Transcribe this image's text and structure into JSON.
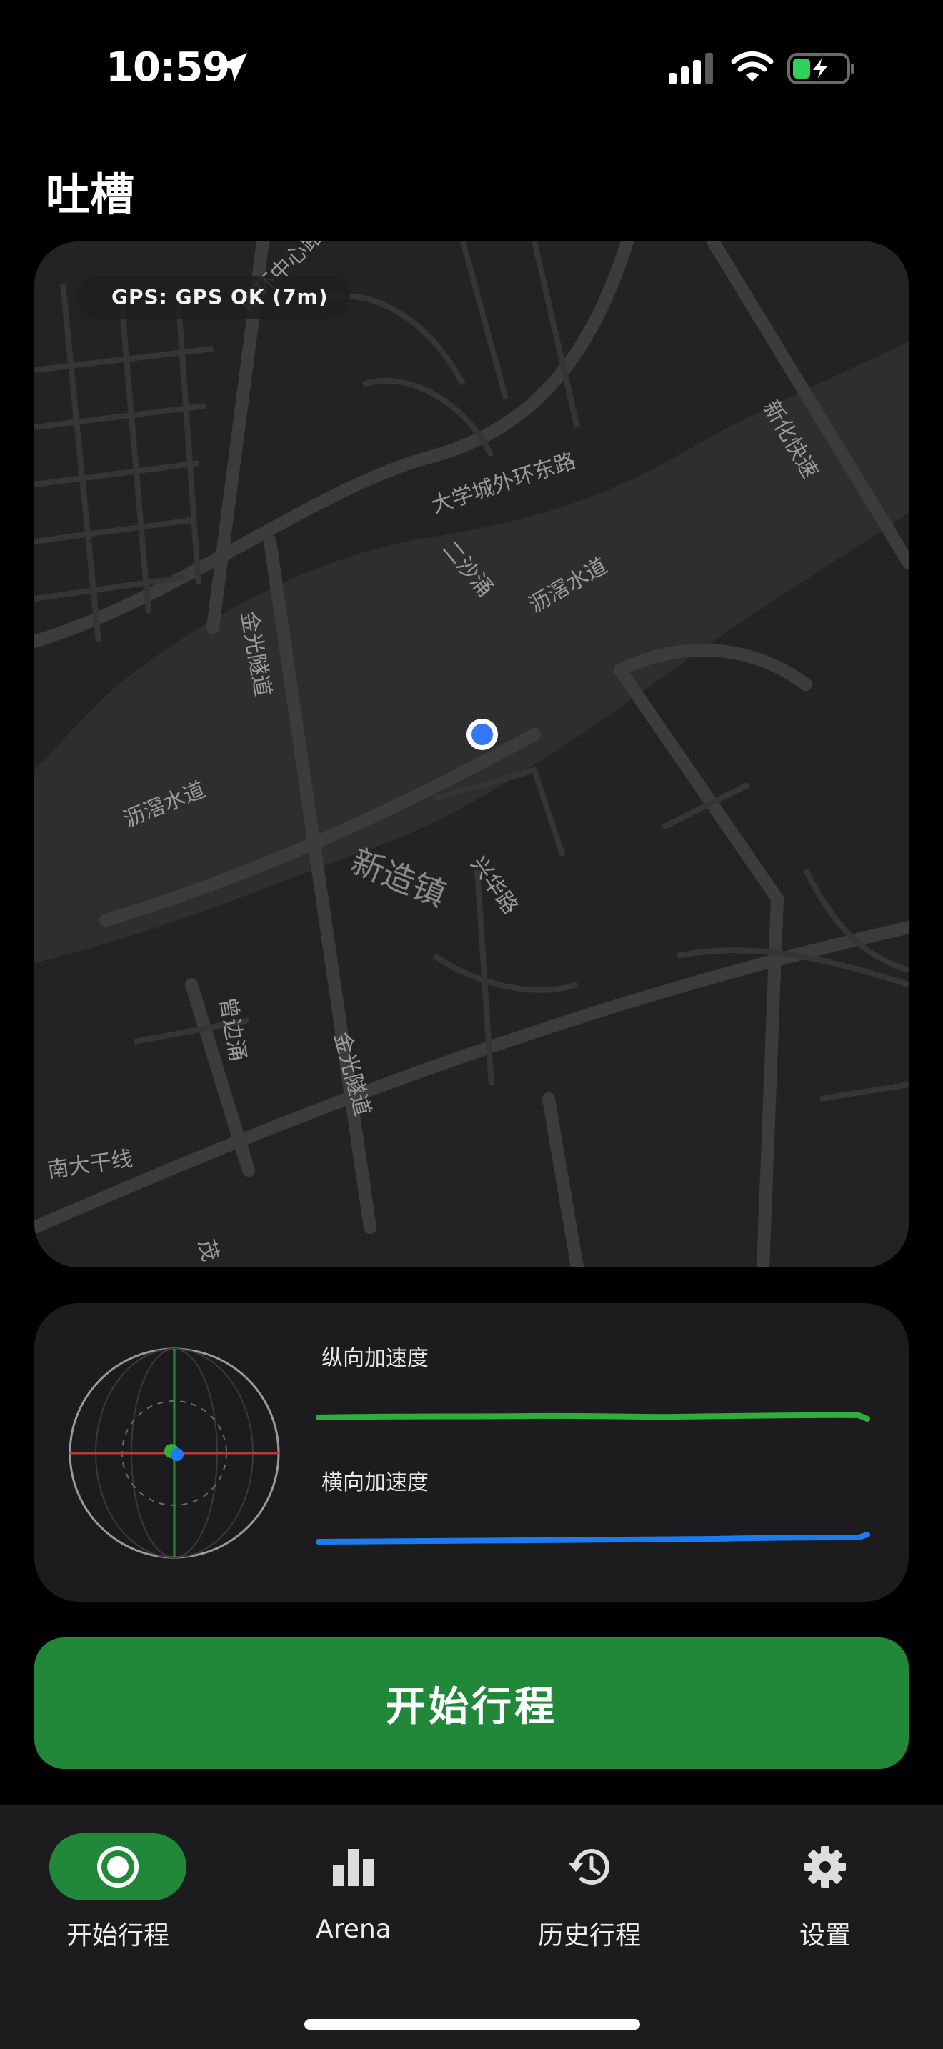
{
  "status_bar": {
    "time": "10:59",
    "icons": [
      "location-arrow-icon",
      "cellular-signal-icon",
      "wifi-icon",
      "battery-charging-icon"
    ]
  },
  "page": {
    "title": "吐槽"
  },
  "map": {
    "gps_status": "GPS: GPS OK (7m)",
    "labels": [
      "大学城外环东路",
      "沥滘水道",
      "沥滘水道",
      "新造镇",
      "兴华路",
      "金光隧道",
      "金光隧道",
      "新化快速",
      "南大干线",
      "二沙涌",
      "曾边涌",
      "南环中心路",
      "茂"
    ],
    "colors": {
      "land": "#232323",
      "water": "#2e2e2e",
      "road": "#3a3a3a",
      "location_dot": "#3478f6"
    }
  },
  "sensors": {
    "longitudinal_label": "纵向加速度",
    "lateral_label": "横向加速度",
    "colors": {
      "longitudinal": "#2fae3c",
      "lateral": "#1a7cf0"
    }
  },
  "actions": {
    "start_trip": "开始行程"
  },
  "tabs": [
    {
      "label": "开始行程",
      "icon": "record-icon",
      "active": true
    },
    {
      "label": "Arena",
      "icon": "bar-chart-icon",
      "active": false
    },
    {
      "label": "历史行程",
      "icon": "history-icon",
      "active": false
    },
    {
      "label": "设置",
      "icon": "gear-icon",
      "active": false
    }
  ],
  "theme": {
    "accent": "#21883a",
    "background": "#000000",
    "card": "#1c1c1e"
  }
}
